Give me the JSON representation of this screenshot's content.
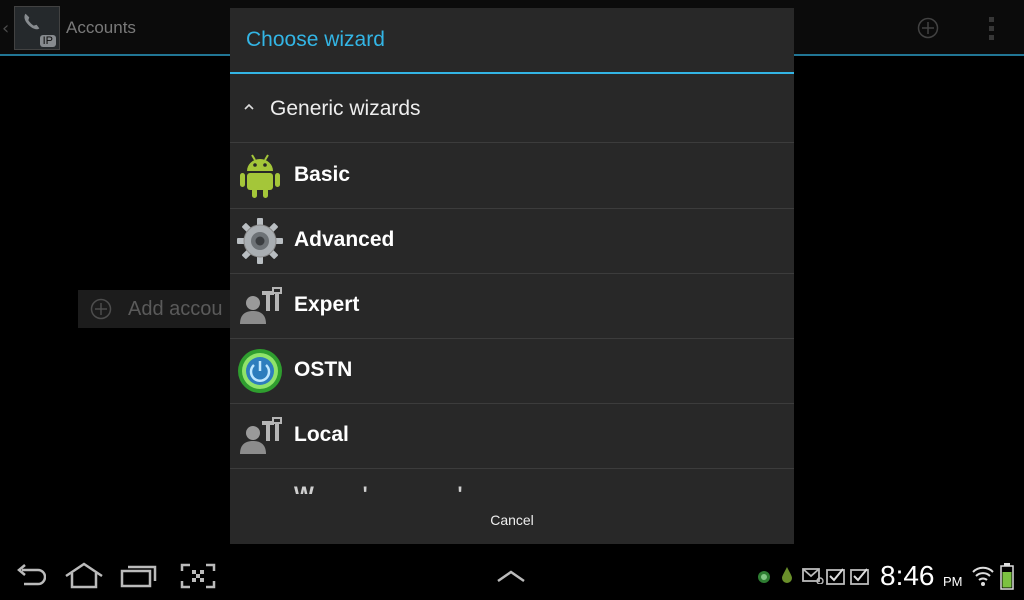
{
  "action_bar": {
    "logo_badge": "IP",
    "title": "Accounts",
    "add_icon": "add-circle-icon",
    "overflow_icon": "overflow-menu-icon"
  },
  "background": {
    "add_account_label": "Add accou"
  },
  "dialog": {
    "title": "Choose wizard",
    "section": {
      "label": "Generic wizards",
      "icon": "chevron-up-icon"
    },
    "items": [
      {
        "label": "Basic",
        "icon": "android-icon"
      },
      {
        "label": "Advanced",
        "icon": "gear-icon"
      },
      {
        "label": "Expert",
        "icon": "user-tools-icon"
      },
      {
        "label": "OSTN",
        "icon": "ostn-power-icon"
      },
      {
        "label": "Local",
        "icon": "user-tools-icon"
      },
      {
        "label": "W . . . ' . .  .  .  .      . ' .",
        "icon": ""
      }
    ],
    "cancel_label": "Cancel"
  },
  "system_bar": {
    "time": "8:46",
    "ampm": "PM"
  },
  "colors": {
    "accent": "#33b5e5",
    "dialog_bg": "#282828",
    "android_green": "#a4c639"
  }
}
